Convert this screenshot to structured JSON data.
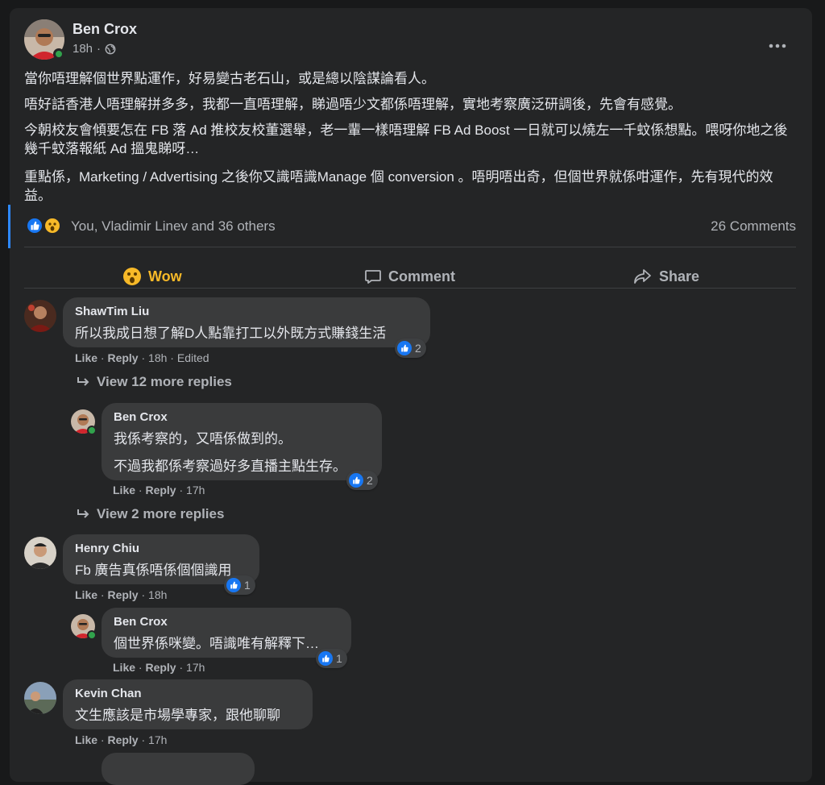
{
  "post": {
    "author": "Ben Crox",
    "time": "18h",
    "paragraphs": [
      "當你唔理解個世界點運作，好易變古老石山，或是總以陰謀論看人。",
      "唔好話香港人唔理解拼多多，我都一直唔理解，睇過唔少文都係唔理解，實地考察廣泛研調後，先會有感覺。",
      "今朝校友會傾要怎在 FB 落 Ad 推校友校董選舉，老一輩一樣唔理解 FB Ad Boost 一日就可以燒左一千蚊係想點。喂呀你地之後幾千蚊落報紙 Ad 搵鬼睇呀…",
      "重點係，Marketing / Advertising 之後你又識唔識Manage 個 conversion 。唔明唔出奇，但個世界就係咁運作，先有現代的效益。"
    ],
    "reactions_text": "You, Vladimir Linev and 36 others",
    "comments_count": "26 Comments"
  },
  "actions": {
    "wow": "Wow",
    "comment": "Comment",
    "share": "Share"
  },
  "labels": {
    "like": "Like",
    "reply": "Reply",
    "sep": "·"
  },
  "comments": [
    {
      "author": "ShawTim Liu",
      "text": "所以我成日想了解D人點靠打工以外既方式賺錢生活",
      "reacts": "2",
      "time": "18h",
      "edited": "Edited",
      "view_more": "View 12 more replies",
      "reply": {
        "author": "Ben Crox",
        "text1": "我係考察的，又唔係做到的。",
        "text2": "不過我都係考察過好多直播主點生存。",
        "reacts": "2",
        "time": "17h",
        "view_more": "View 2 more replies"
      }
    },
    {
      "author": "Henry Chiu",
      "text": "Fb 廣告真係唔係個個識用",
      "reacts": "1",
      "time": "18h",
      "reply": {
        "author": "Ben Crox",
        "text": "個世界係咪變。唔識唯有解釋下…",
        "reacts": "1",
        "time": "17h"
      }
    },
    {
      "author": "Kevin Chan",
      "text": "文生應該是市場學專家，跟他聊聊",
      "time": "17h"
    }
  ],
  "colors": {
    "background": "#18191a",
    "card": "#242526",
    "bubble": "#3a3b3c",
    "accent_blue": "#2d88ff",
    "wow_yellow": "#f7b928",
    "online_green": "#31a24c"
  }
}
